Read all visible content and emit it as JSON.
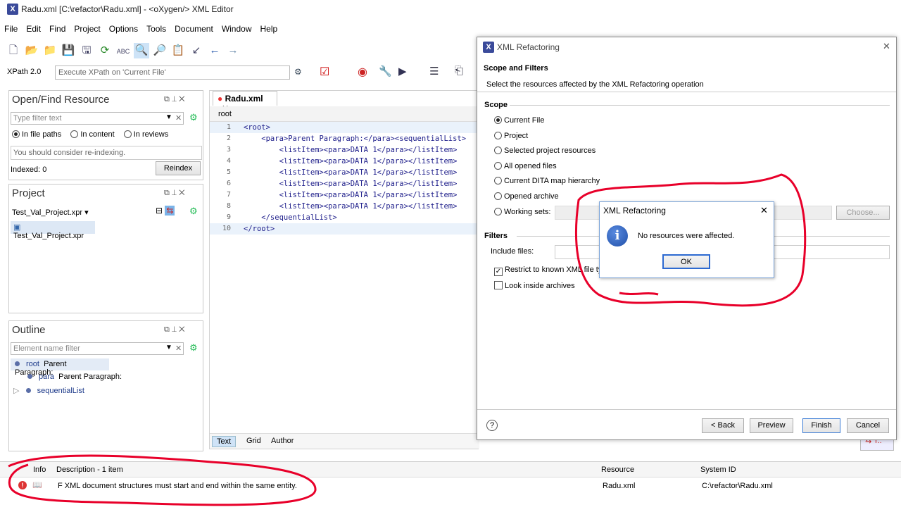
{
  "window": {
    "title": "Radu.xml [C:\\refactor\\Radu.xml] - <oXygen/> XML Editor",
    "app_icon": "X"
  },
  "menu": [
    "File",
    "Edit",
    "Find",
    "Project",
    "Options",
    "Tools",
    "Document",
    "Window",
    "Help"
  ],
  "xpath": {
    "version": "XPath 2.0",
    "placeholder": "Execute XPath on  'Current File'"
  },
  "open_find": {
    "title": "Open/Find Resource",
    "filter_placeholder": "Type filter text",
    "options": [
      "In file paths",
      "In content",
      "In reviews"
    ],
    "hint": "You should consider re-indexing.",
    "indexed": "Indexed: 0",
    "reindex": "Reindex"
  },
  "project": {
    "title": "Project",
    "name": "Test_Val_Project.xpr",
    "item": "Test_Val_Project.xpr"
  },
  "outline": {
    "title": "Outline",
    "filter_placeholder": "Element name filter",
    "items": [
      {
        "name": "root",
        "text": "Parent Paragraph:"
      },
      {
        "name": "para",
        "text": "Parent Paragraph:"
      },
      {
        "name": "sequentialList",
        "text": ""
      }
    ]
  },
  "editor": {
    "tab": "Radu.xml",
    "breadcrumb": "root",
    "lines": [
      "<root>",
      "    <para>Parent Paragraph:</para><sequentialList>",
      "        <listItem><para>DATA 1</para></listItem>",
      "        <listItem><para>DATA 1</para></listItem>",
      "        <listItem><para>DATA 1</para></listItem>",
      "        <listItem><para>DATA 1</para></listItem>",
      "        <listItem><para>DATA 1</para></listItem>",
      "        <listItem><para>DATA 1</para></listItem>",
      "    </sequentialList>",
      "</root>"
    ],
    "line_numbers": [
      "1",
      "2",
      "3",
      "4",
      "5",
      "6",
      "7",
      "8",
      "9",
      "10"
    ],
    "modes": [
      "Text",
      "Grid",
      "Author"
    ]
  },
  "refactor": {
    "title": "XML Refactoring",
    "heading": "Scope and Filters",
    "subheading": "Select the resources affected by the XML Refactoring operation",
    "scope_label": "Scope",
    "scope_options": [
      "Current File",
      "Project",
      "Selected project resources",
      "All opened files",
      "Current DITA map hierarchy",
      "Opened archive",
      "Working sets:"
    ],
    "choose": "Choose...",
    "filters_label": "Filters",
    "include_files": "Include files:",
    "restrict": "Restrict to known XML file types",
    "look_inside": "Look inside archives",
    "help": "?",
    "back": "< Back",
    "preview": "Preview",
    "finish": "Finish",
    "cancel": "Cancel"
  },
  "alert": {
    "title": "XML Refactoring",
    "message": "No resources were affected.",
    "ok": "OK",
    "close": "✕",
    "icon": "i"
  },
  "problems": {
    "col_info": "Info",
    "col_desc": "Description - 1 item",
    "col_resource": "Resource",
    "col_sysid": "System ID",
    "row": {
      "msg": "F XML document structures must start and end within the same entity.",
      "resource": "Radu.xml",
      "sysid": "C:\\refactor\\Radu.xml"
    }
  },
  "colors": {
    "annotation": "#e8002a",
    "accent": "#3a4a9a"
  }
}
